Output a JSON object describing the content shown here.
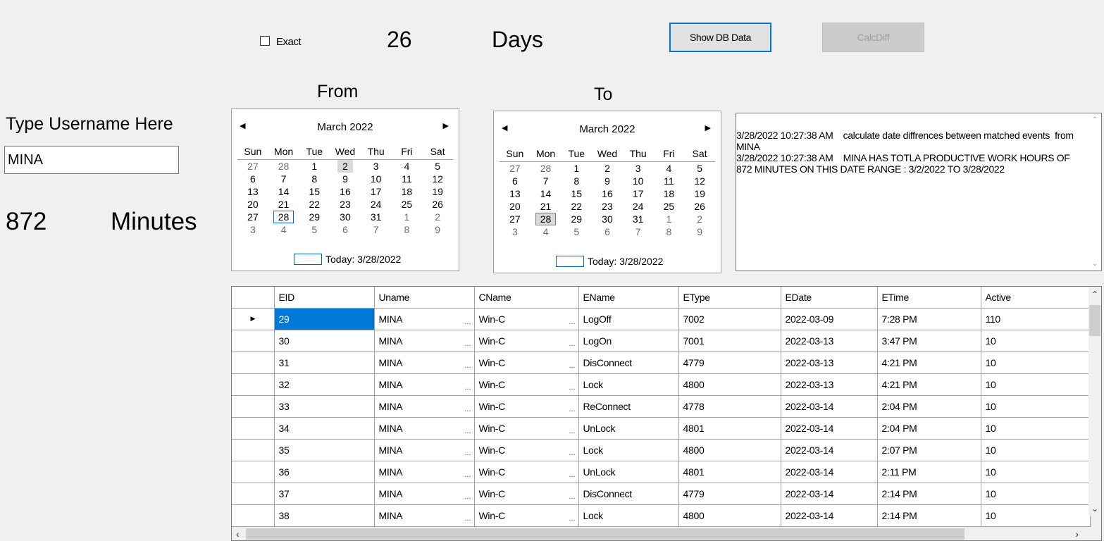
{
  "top": {
    "exact_label": "Exact",
    "days_value": "26",
    "days_label": "Days",
    "show_db_button": "Show DB Data",
    "calc_diff_button": "CalcDiff"
  },
  "labels": {
    "from": "From",
    "to": "To",
    "username_prompt": "Type Username Here",
    "minutes_value": "872",
    "minutes_label": "Minutes"
  },
  "username_input": {
    "value": "MINA"
  },
  "calendar_from": {
    "month_title": "March 2022",
    "weekdays": [
      "Sun",
      "Mon",
      "Tue",
      "Wed",
      "Thu",
      "Fri",
      "Sat"
    ],
    "weeks": [
      [
        "27",
        "28",
        "1",
        "2",
        "3",
        "4",
        "5"
      ],
      [
        "6",
        "7",
        "8",
        "9",
        "10",
        "11",
        "12"
      ],
      [
        "13",
        "14",
        "15",
        "16",
        "17",
        "18",
        "19"
      ],
      [
        "20",
        "21",
        "22",
        "23",
        "24",
        "25",
        "26"
      ],
      [
        "27",
        "28",
        "29",
        "30",
        "31",
        "1",
        "2"
      ],
      [
        "3",
        "4",
        "5",
        "6",
        "7",
        "8",
        "9"
      ]
    ],
    "today_text": "Today: 3/28/2022"
  },
  "calendar_to": {
    "month_title": "March 2022",
    "weekdays": [
      "Sun",
      "Mon",
      "Tue",
      "Wed",
      "Thu",
      "Fri",
      "Sat"
    ],
    "weeks": [
      [
        "27",
        "28",
        "1",
        "2",
        "3",
        "4",
        "5"
      ],
      [
        "6",
        "7",
        "8",
        "9",
        "10",
        "11",
        "12"
      ],
      [
        "13",
        "14",
        "15",
        "16",
        "17",
        "18",
        "19"
      ],
      [
        "20",
        "21",
        "22",
        "23",
        "24",
        "25",
        "26"
      ],
      [
        "27",
        "28",
        "29",
        "30",
        "31",
        "1",
        "2"
      ],
      [
        "3",
        "4",
        "5",
        "6",
        "7",
        "8",
        "9"
      ]
    ],
    "today_text": "Today: 3/28/2022"
  },
  "log": {
    "text": "3/28/2022 10:27:38 AM    calculate date diffrences between matched events  from MINA\n3/28/2022 10:27:38 AM    MINA HAS TOTLA PRODUCTIVE WORK HOURS OF 872 MINUTES ON THIS DATE RANGE : 3/2/2022 TO 3/28/2022"
  },
  "grid": {
    "columns": [
      "EID",
      "Uname",
      "CName",
      "EName",
      "EType",
      "EDate",
      "ETime",
      "Active"
    ],
    "rows": [
      [
        "29",
        "MINA",
        "Win-C",
        "LogOff",
        "7002",
        "2022-03-09",
        "7:28 PM",
        "110"
      ],
      [
        "30",
        "MINA",
        "Win-C",
        "LogOn",
        "7001",
        "2022-03-13",
        "3:47 PM",
        "10"
      ],
      [
        "31",
        "MINA",
        "Win-C",
        "DisConnect",
        "4779",
        "2022-03-13",
        "4:21 PM",
        "10"
      ],
      [
        "32",
        "MINA",
        "Win-C",
        "Lock",
        "4800",
        "2022-03-13",
        "4:21 PM",
        "10"
      ],
      [
        "33",
        "MINA",
        "Win-C",
        "ReConnect",
        "4778",
        "2022-03-14",
        "2:04 PM",
        "10"
      ],
      [
        "34",
        "MINA",
        "Win-C",
        "UnLock",
        "4801",
        "2022-03-14",
        "2:04 PM",
        "10"
      ],
      [
        "35",
        "MINA",
        "Win-C",
        "Lock",
        "4800",
        "2022-03-14",
        "2:07 PM",
        "10"
      ],
      [
        "36",
        "MINA",
        "Win-C",
        "UnLock",
        "4801",
        "2022-03-14",
        "2:11 PM",
        "10"
      ],
      [
        "37",
        "MINA",
        "Win-C",
        "DisConnect",
        "4779",
        "2022-03-14",
        "2:14 PM",
        "10"
      ],
      [
        "38",
        "MINA",
        "Win-C",
        "Lock",
        "4800",
        "2022-03-14",
        "2:14 PM",
        "10"
      ]
    ],
    "ellipsis": "..."
  }
}
